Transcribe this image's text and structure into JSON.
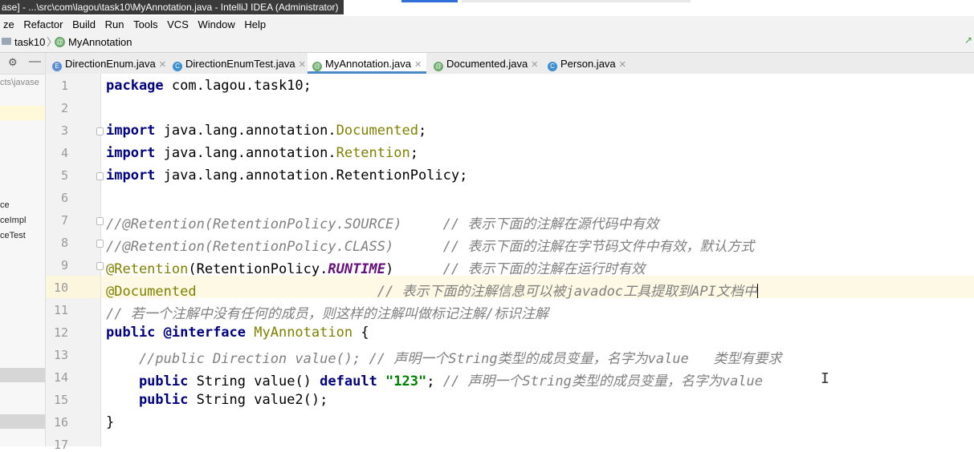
{
  "window": {
    "title": "ase] - ...\\src\\com\\lagou\\task10\\MyAnnotation.java - IntelliJ IDEA (Administrator)"
  },
  "menu": [
    "ze",
    "Refactor",
    "Build",
    "Run",
    "Tools",
    "VCS",
    "Window",
    "Help"
  ],
  "breadcrumb": {
    "folder": "task10",
    "file": "MyAnnotation"
  },
  "project_panel": {
    "path_fragment": "cts\\javase",
    "items": [
      "ce",
      "ceImpl",
      "ceTest"
    ]
  },
  "tabs": [
    {
      "label": "DirectionEnum.java",
      "icon": "E",
      "color": "#5b8dd6"
    },
    {
      "label": "DirectionEnumTest.java",
      "icon": "C",
      "color": "#3c8fd0"
    },
    {
      "label": "MyAnnotation.java",
      "icon": "@",
      "color": "#6aaa6a",
      "active": true
    },
    {
      "label": "Documented.java",
      "icon": "@",
      "color": "#6aaa6a"
    },
    {
      "label": "Person.java",
      "icon": "C",
      "color": "#3c8fd0"
    }
  ],
  "code": {
    "line_numbers": [
      "1",
      "2",
      "3",
      "4",
      "5",
      "6",
      "7",
      "8",
      "9",
      "10",
      "11",
      "12",
      "13",
      "14",
      "15",
      "16",
      "17"
    ],
    "l1": {
      "kw": "package",
      "rest": " com.lagou.task10;"
    },
    "l3": {
      "kw": "import",
      "pkg": " java.lang.annotation.",
      "cls": "Documented",
      "end": ";"
    },
    "l4": {
      "kw": "import",
      "pkg": " java.lang.annotation.",
      "cls": "Retention",
      "end": ";"
    },
    "l5": {
      "kw": "import",
      "rest": " java.lang.annotation.RetentionPolicy;"
    },
    "l7": {
      "code": "//@Retention(RetentionPolicy.SOURCE)     ",
      "cmt": "// 表示下面的注解在源代码中有效"
    },
    "l8": {
      "code": "//@Retention(RetentionPolicy.CLASS)      ",
      "cmt": "// 表示下面的注解在字节码文件中有效，默认方式"
    },
    "l9": {
      "ann": "@Retention",
      "open": "(RetentionPolicy.",
      "const": "RUNTIME",
      "close": ")      ",
      "cmt": "// 表示下面的注解在运行时有效"
    },
    "l10": {
      "ann": "@Documented",
      "pad": "                      ",
      "cmt": "// 表示下面的注解信息可以被javadoc工具提取到API文档中"
    },
    "l11": {
      "cmt": "// 若一个注解中没有任何的成员，则这样的注解叫做标记注解/标识注解"
    },
    "l12": {
      "kw1": "public",
      "kw2": " @interface",
      "name": " MyAnnotation",
      "end": " {"
    },
    "l13": {
      "cmt": "    //public Direction value(); // 声明一个String类型的成员变量，名字为value   类型有要求"
    },
    "l14": {
      "kw": "    public",
      "type": " String ",
      "meth": "value",
      "paren": "() ",
      "kw2": "default",
      "str": " \"123\"",
      "semi": "; ",
      "cmt": "// 声明一个String类型的成员变量，名字为value"
    },
    "l15": {
      "kw": "    public",
      "rest": " String value2();"
    },
    "l16": {
      "rest": "}"
    }
  },
  "colors": {
    "keyword": "#000080",
    "annotation": "#808000",
    "comment": "#808080",
    "constant": "#660e7a",
    "string": "#008000",
    "current_line": "#fdf9e4",
    "active_tab_underline": "#4a88c7"
  }
}
